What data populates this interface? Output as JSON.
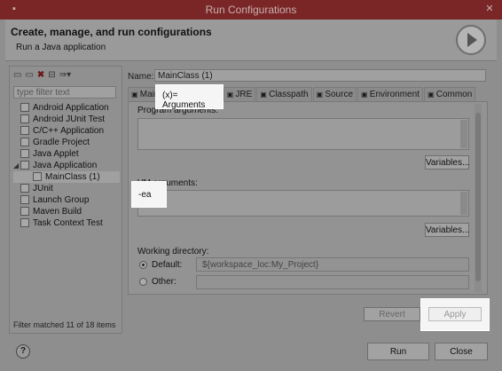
{
  "window": {
    "title": "Run Configurations"
  },
  "header": {
    "title": "Create, manage, and run configurations",
    "subtitle": "Run a Java application"
  },
  "left": {
    "filter_placeholder": "type filter text",
    "toolbar": [
      "new-icon",
      "duplicate-icon",
      "delete-icon",
      "collapse-icon",
      "filter-icon"
    ],
    "tree": [
      {
        "label": "Android Application",
        "icon": "android-icon",
        "level": 0
      },
      {
        "label": "Android JUnit Test",
        "icon": "junit-icon",
        "level": 0
      },
      {
        "label": "C/C++ Application",
        "icon": "c-icon",
        "level": 0
      },
      {
        "label": "Gradle Project",
        "icon": "gradle-icon",
        "level": 0
      },
      {
        "label": "Java Applet",
        "icon": "applet-icon",
        "level": 0
      },
      {
        "label": "Java Application",
        "icon": "java-icon",
        "level": 0,
        "expanded": true
      },
      {
        "label": "MainClass (1)",
        "icon": "java-class-icon",
        "level": 1
      },
      {
        "label": "JUnit",
        "icon": "junit-icon",
        "level": 0
      },
      {
        "label": "Launch Group",
        "icon": "launch-icon",
        "level": 0
      },
      {
        "label": "Maven Build",
        "icon": "maven-icon",
        "level": 0
      },
      {
        "label": "Task Context Test",
        "icon": "junit-icon",
        "level": 0
      }
    ],
    "filter_status": "Filter matched 11 of 18 items"
  },
  "config": {
    "name_label": "Name:",
    "name_value": "MainClass (1)",
    "tabs": [
      {
        "label": "Main",
        "icon": "main-icon"
      },
      {
        "label": "Arguments",
        "icon": "args-icon",
        "active": true
      },
      {
        "label": "JRE",
        "icon": "jre-icon"
      },
      {
        "label": "Classpath",
        "icon": "classpath-icon"
      },
      {
        "label": "Source",
        "icon": "source-icon"
      },
      {
        "label": "Environment",
        "icon": "env-icon"
      },
      {
        "label": "Common",
        "icon": "common-icon"
      }
    ],
    "program_args_label": "Program arguments:",
    "program_args_value": "",
    "variables_label": "Variables...",
    "vm_args_label": "VM arguments:",
    "vm_args_value": "-ea",
    "working_dir_label": "Working directory:",
    "default_label": "Default:",
    "default_value": "${workspace_loc:My_Project}",
    "other_label": "Other:",
    "revert_label": "Revert",
    "apply_label": "Apply"
  },
  "footer": {
    "help": "?",
    "run_label": "Run",
    "close_label": "Close"
  }
}
